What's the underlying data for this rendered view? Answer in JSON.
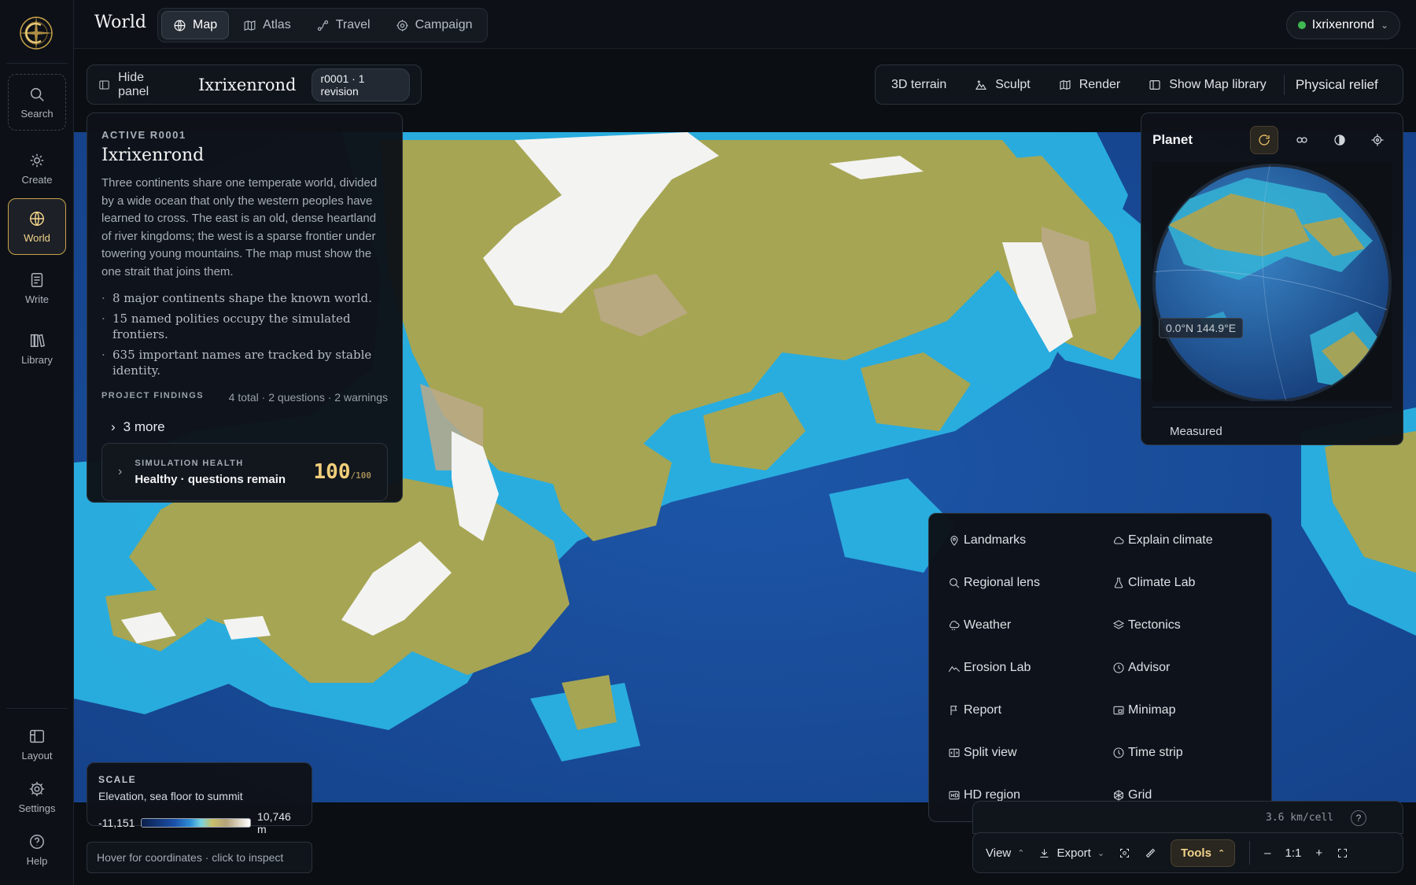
{
  "rail": {
    "items": [
      {
        "label": "Search",
        "icon": "search-icon"
      },
      {
        "label": "Create",
        "icon": "sparkle-icon"
      },
      {
        "label": "World",
        "icon": "globe-icon"
      },
      {
        "label": "Write",
        "icon": "document-icon"
      },
      {
        "label": "Library",
        "icon": "books-icon"
      }
    ],
    "bottom": [
      {
        "label": "Layout",
        "icon": "layout-icon"
      },
      {
        "label": "Settings",
        "icon": "gear-icon"
      },
      {
        "label": "Help",
        "icon": "help-icon"
      }
    ],
    "active": "World",
    "accent": "#c9a24a"
  },
  "topbar": {
    "title": "World",
    "tabs": [
      {
        "label": "Map",
        "icon": "globe-icon"
      },
      {
        "label": "Atlas",
        "icon": "map-icon"
      },
      {
        "label": "Travel",
        "icon": "route-icon"
      },
      {
        "label": "Campaign",
        "icon": "target-icon"
      }
    ],
    "active_tab": "Map",
    "account": "Ixrixenrond",
    "account_status_color": "#3fb950"
  },
  "panel_header": {
    "hide_label": "Hide panel",
    "world_name": "Ixrixenrond",
    "revision": "r0001 · 1 revision"
  },
  "toolbar": {
    "items": [
      "3D terrain",
      "Sculpt",
      "Render",
      "Show Map library"
    ],
    "relief": "Physical relief"
  },
  "info": {
    "active_label": "ACTIVE R0001",
    "title": "Ixrixenrond",
    "description": "Three continents share one temperate world, divided by a wide ocean that only the western peoples have learned to cross. The east is an old, dense heartland of river kingdoms; the west is a sparse frontier under towering young mountains. The map must show the one strait that joins them.",
    "facts": [
      "8 major continents shape the known world.",
      "15 named polities occupy the simulated frontiers.",
      "635 important names are tracked by stable identity."
    ],
    "findings_label": "PROJECT FINDINGS",
    "findings_summary": "4 total · 2 questions · 2 warnings",
    "more": "3 more",
    "sim_label": "SIMULATION HEALTH",
    "sim_status": "Healthy · questions remain",
    "sim_score": "100",
    "sim_max": "/100"
  },
  "planet": {
    "title": "Planet",
    "icons": [
      "refresh-icon",
      "orbit-icon",
      "contrast-icon",
      "locate-icon"
    ],
    "coords": "0.0°N 144.9°E",
    "measured": "Measured"
  },
  "tools_menu": {
    "items": [
      {
        "label": "Landmarks",
        "icon": "pin-icon"
      },
      {
        "label": "Explain climate",
        "icon": "cloud-icon"
      },
      {
        "label": "Regional lens",
        "icon": "search-icon"
      },
      {
        "label": "Climate Lab",
        "icon": "flask-icon"
      },
      {
        "label": "Weather",
        "icon": "cloud-rain-icon"
      },
      {
        "label": "Tectonics",
        "icon": "layers-icon"
      },
      {
        "label": "Erosion Lab",
        "icon": "mountain-icon"
      },
      {
        "label": "Advisor",
        "icon": "compass-icon"
      },
      {
        "label": "Report",
        "icon": "flag-icon"
      },
      {
        "label": "Minimap",
        "icon": "minimap-icon"
      },
      {
        "label": "Split view",
        "icon": "split-icon"
      },
      {
        "label": "Time strip",
        "icon": "clock-icon"
      },
      {
        "label": "HD region",
        "icon": "hd-icon"
      },
      {
        "label": "Grid",
        "icon": "grid-icon"
      }
    ]
  },
  "scale": {
    "label": "SCALE",
    "description": "Elevation, sea floor to summit",
    "min": "-11,151",
    "max": "10,746 m"
  },
  "hover_hint": "Hover for coordinates · click to inspect",
  "status": {
    "cell": "3.6 km/cell",
    "help": "?",
    "view": "View",
    "export": "Export",
    "tools": "Tools",
    "zoom_out": "–",
    "zoom": "1:1",
    "zoom_in": "+"
  },
  "colors": {
    "ocean_deep": "#1a4e9c",
    "ocean_shelf": "#29b6e3",
    "lowland": "#a9a552",
    "summit": "#ffffff",
    "tools_accent": "#f1d38a"
  }
}
